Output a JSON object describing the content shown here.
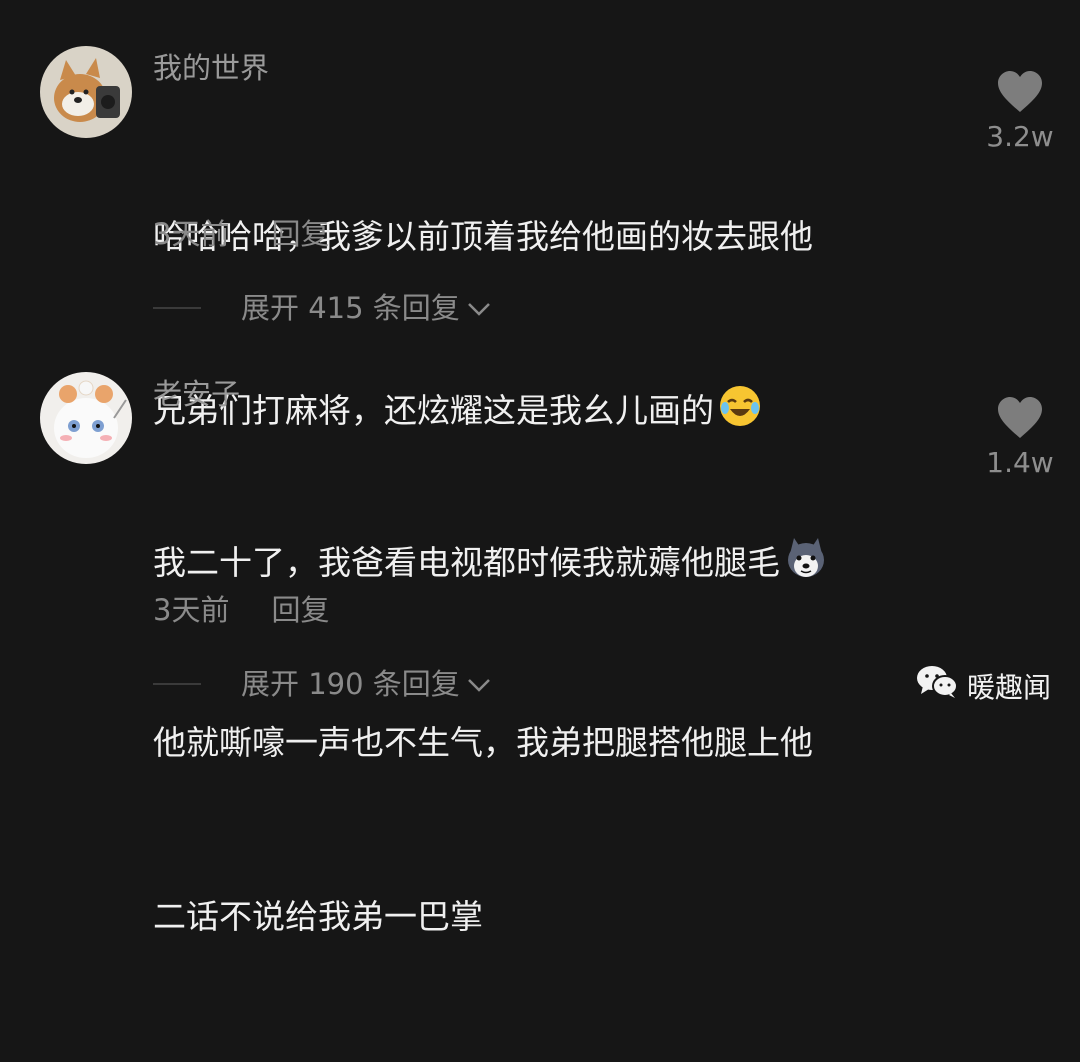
{
  "comments": [
    {
      "username": "我的世界",
      "text_line1": "哈哈哈哈，我爹以前顶着我给他画的妆去跟他",
      "text_line2": "兄弟们打麻将，还炫耀这是我幺儿画的",
      "time": "3天前",
      "reply_label": "回复",
      "likes": "3.2w",
      "expand_label": "展开 415 条回复",
      "emoji": "laughing-tears-emoji"
    },
    {
      "username": "老安子",
      "text_line1": "我二十了，我爸看电视都时候我就薅他腿毛",
      "text_line2": "他就嘶嚎一声也不生气，我弟把腿搭他腿上他",
      "text_line3": "二话不说给我弟一巴掌",
      "time": "3天前",
      "reply_label": "回复",
      "likes": "1.4w",
      "expand_label": "展开 190 条回复",
      "emoji": "husky-emoji"
    }
  ],
  "watermark": {
    "label": "暖趣闻",
    "icon": "wechat-icon"
  },
  "colors": {
    "background": "#161616",
    "text": "#f0f0f0",
    "muted": "#8a8a8a"
  }
}
